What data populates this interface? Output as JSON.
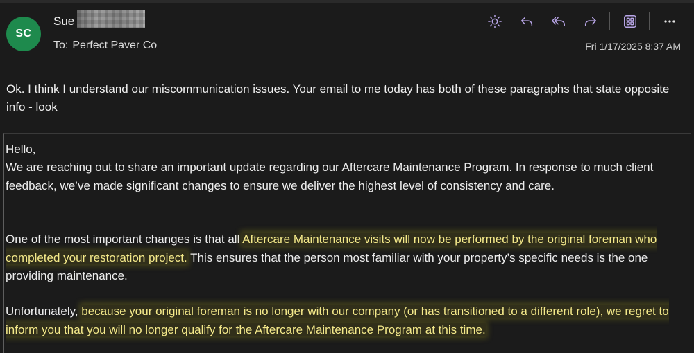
{
  "email": {
    "avatar_initials": "SC",
    "avatar_color": "#1e8a4d",
    "sender_name": "Sue",
    "to_label": "To:",
    "to_name": "Perfect Paver Co",
    "date": "Fri 1/17/2025 8:37 AM"
  },
  "toolbar": {
    "icons": [
      "sun-icon",
      "reply-icon",
      "reply-all-icon",
      "forward-icon",
      "apps-icon",
      "more-icon"
    ],
    "accent_color": "#b9a6e8"
  },
  "body": {
    "intro": "Ok. I think I understand our miscommunication issues. Your email to me today has both of these paragraphs that state opposite info - look",
    "quote": {
      "hello": "Hello,",
      "para1": "We are reaching out to share an important update regarding our Aftercare Maintenance Program. In response to much client feedback, we’ve made significant changes to ensure we deliver the highest level of consistency and care.",
      "para2_pre": "One of the most important changes is that all ",
      "para2_highlight": "Aftercare Maintenance visits will now be performed by the original foreman who completed your restoration project.",
      "para2_post": " This ensures that the person most familiar with your property’s specific needs is the one providing maintenance.",
      "para3_pre": "Unfortunately, ",
      "para3_highlight": "because your original foreman is no longer with our company (or has transitioned to a different role), we regret to inform you that you will no longer qualify for the Aftercare Maintenance Program at this time.",
      "highlight_color": "#f4e98a"
    }
  }
}
